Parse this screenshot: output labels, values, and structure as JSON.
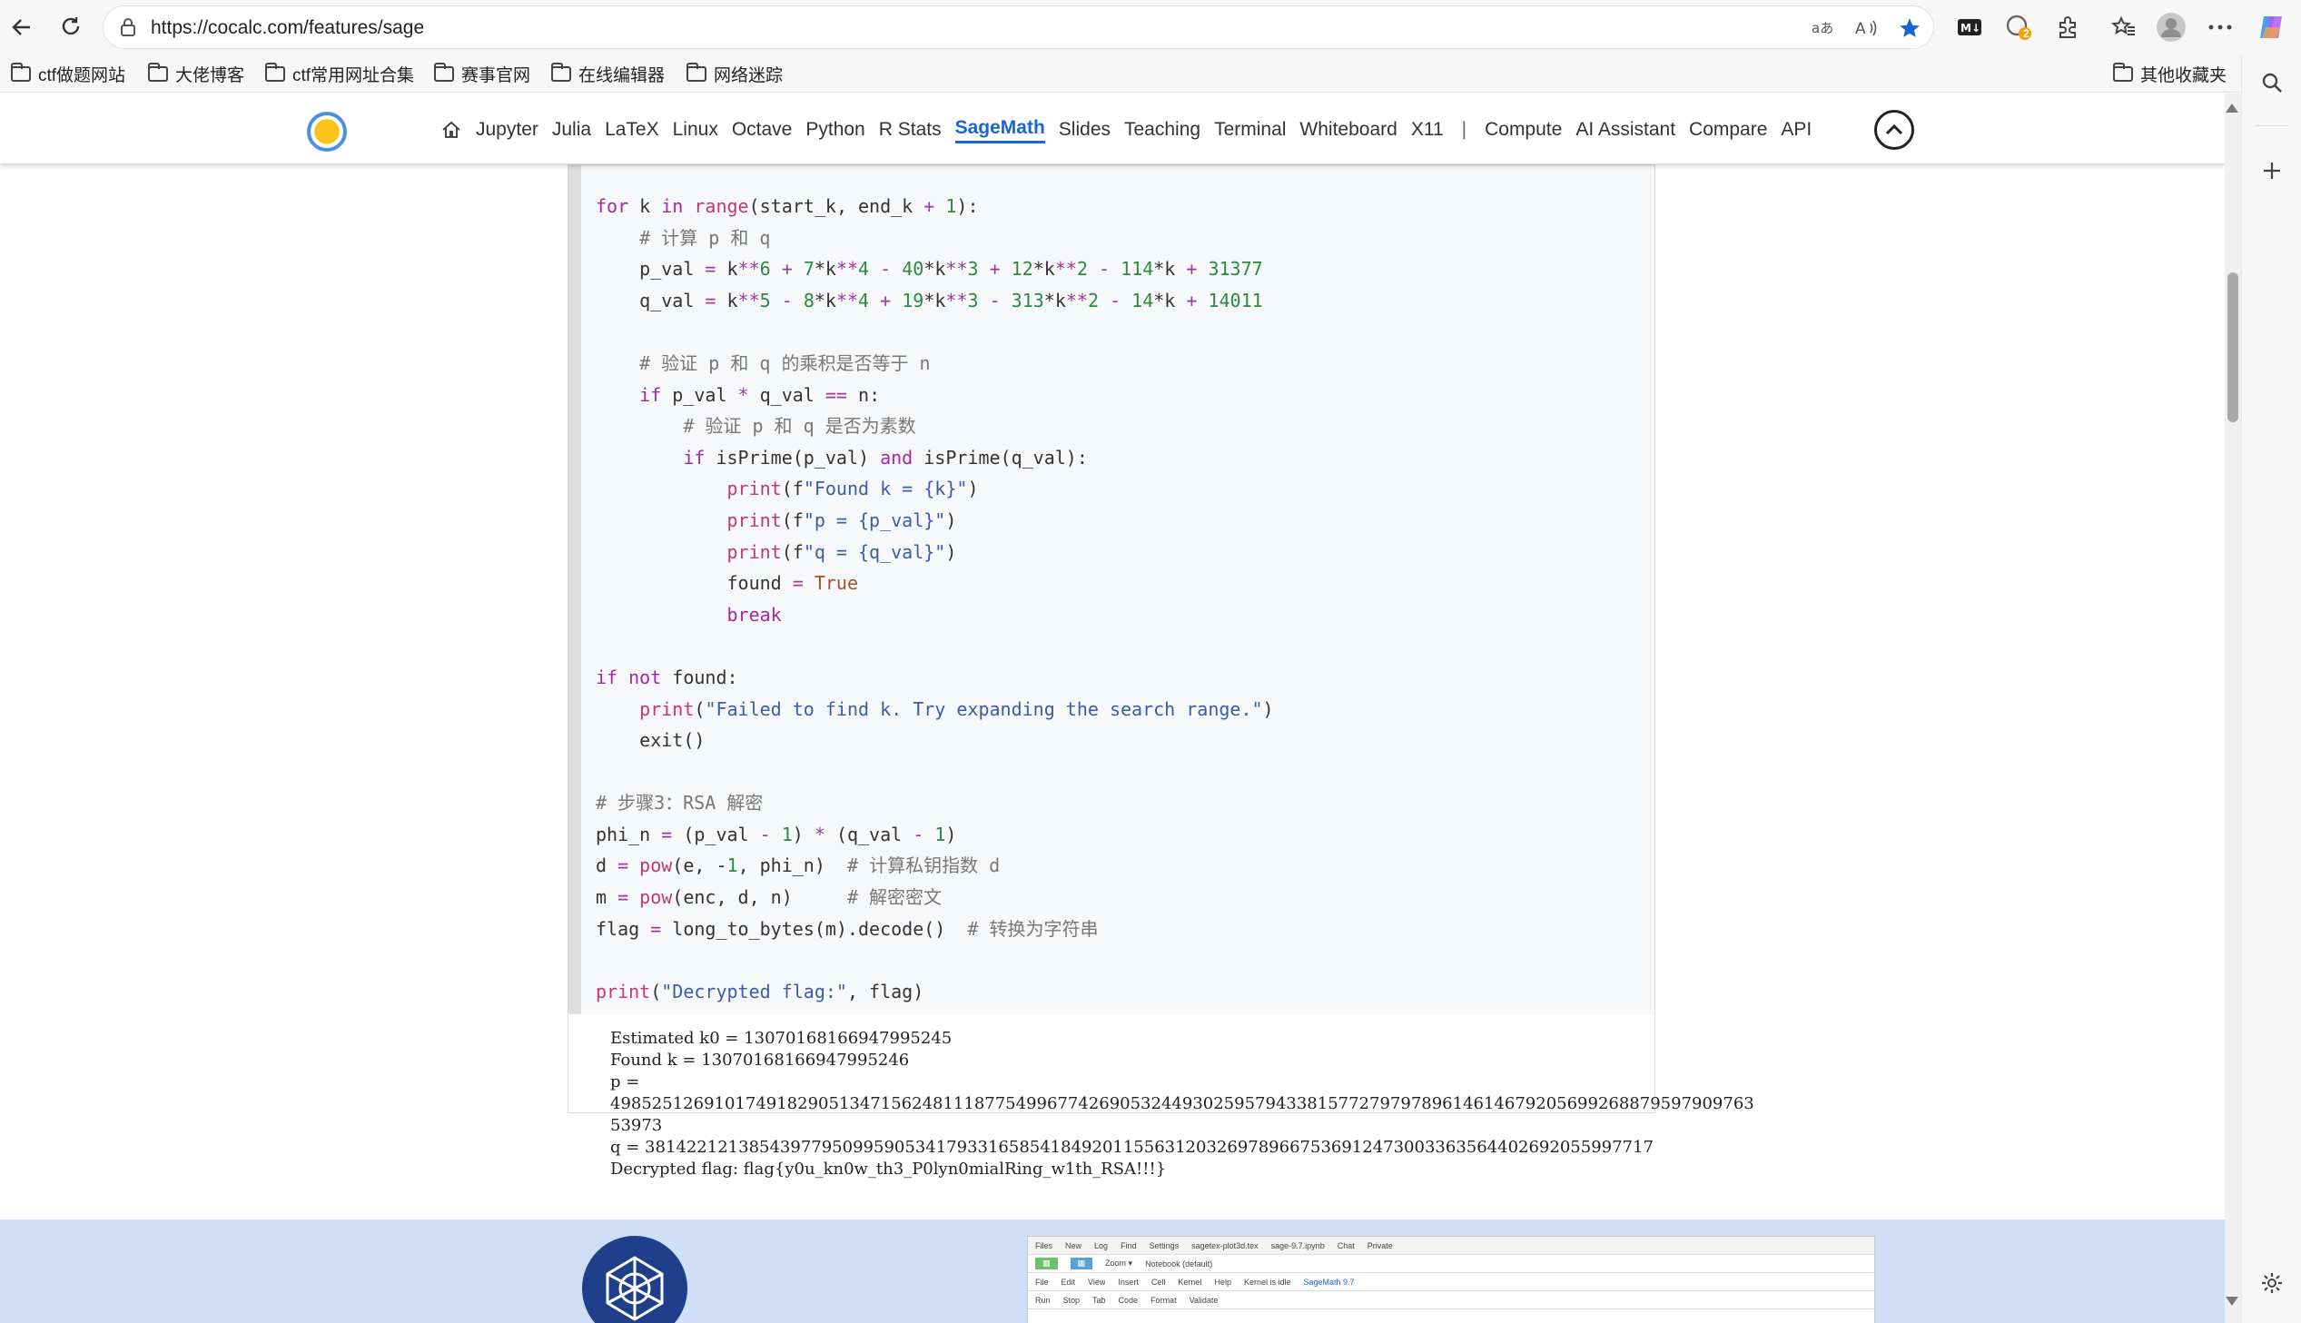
{
  "browser": {
    "url": "https://cocalc.com/features/sage",
    "bookmarks": [
      "ctf做题网站",
      "大佬博客",
      "ctf常用网址合集",
      "赛事官网",
      "在线编辑器",
      "网络迷踪"
    ],
    "other_bookmarks": "其他收藏夹",
    "badge_count": "2"
  },
  "site_nav": {
    "items": [
      "Jupyter",
      "Julia",
      "LaTeX",
      "Linux",
      "Octave",
      "Python",
      "R Stats",
      "SageMath",
      "Slides",
      "Teaching",
      "Terminal",
      "Whiteboard",
      "X11",
      "Compute",
      "AI Assistant",
      "Compare",
      "API"
    ],
    "active": "SageMath",
    "separator": "|"
  },
  "code_lines": [
    "for k in range(start_k, end_k + 1):",
    "    # 计算 p 和 q",
    "    p_val = k**6 + 7*k**4 - 40*k**3 + 12*k**2 - 114*k + 31377",
    "    q_val = k**5 - 8*k**4 + 19*k**3 - 313*k**2 - 14*k + 14011",
    "",
    "    # 验证 p 和 q 的乘积是否等于 n",
    "    if p_val * q_val == n:",
    "        # 验证 p 和 q 是否为素数",
    "        if isPrime(p_val) and isPrime(q_val):",
    "            print(f\"Found k = {k}\")",
    "            print(f\"p = {p_val}\")",
    "            print(f\"q = {q_val}\")",
    "            found = True",
    "            break",
    "",
    "if not found:",
    "    print(\"Failed to find k. Try expanding the search range.\")",
    "    exit()",
    "",
    "# 步骤3：RSA 解密",
    "phi_n = (p_val - 1) * (q_val - 1)",
    "d = pow(e, -1, phi_n)  # 计算私钥指数 d",
    "m = pow(enc, d, n)     # 解密密文",
    "flag = long_to_bytes(m).decode()  # 转换为字符串",
    "",
    "print(\"Decrypted flag:\", flag)"
  ],
  "output_lines": [
    "Estimated k0 = 13070168166947995245",
    "Found k = 13070168166947995246",
    "p =",
    "49852512691017491829051347156248111877549967742690532449302595794338157727979789614614679205699268879597909763",
    "53973",
    "q = 3814221213854397795099590534179331658541849201155631203269789667536912473003363564402692055997717",
    "Decrypted flag: flag{y0u_kn0w_th3_P0lyn0mialRing_w1th_RSA!!!}"
  ],
  "preview": {
    "tabs": [
      "Files",
      "New",
      "Log",
      "Find",
      "Settings",
      "sagetex-plot3d.tex",
      "sage-9.7.ipynb",
      "Chat",
      "Private"
    ],
    "menu": [
      "File",
      "Edit",
      "View",
      "Insert",
      "Cell",
      "Kernel",
      "Help"
    ],
    "kernel_status": "Kernel is idle",
    "kernel_name": "SageMath 9.7",
    "toolbar": [
      "Run",
      "Stop",
      "Tab",
      "Code",
      "Format",
      "Validate"
    ],
    "notebook_label": "Notebook (default)"
  },
  "colors": {
    "accent": "#1b64d8",
    "banner": "#cfe0f6",
    "code_bg": "#f7f8fa"
  }
}
